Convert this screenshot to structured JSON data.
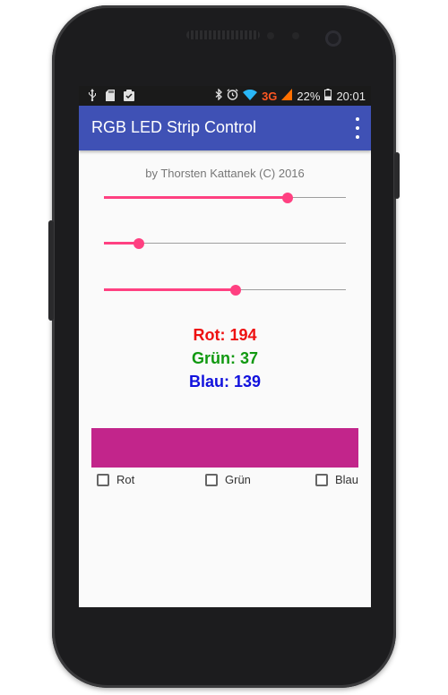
{
  "statusbar": {
    "left_icons": [
      "usb-icon",
      "sd-card-icon",
      "clipboard-icon"
    ],
    "network": "3G",
    "battery": "22%",
    "time": "20:01"
  },
  "appbar": {
    "title": "RGB LED Strip Control"
  },
  "byline": "by Thorsten Kattanek (C) 2016",
  "sliders": {
    "red": {
      "value": 194,
      "max": 255
    },
    "green": {
      "value": 37,
      "max": 255
    },
    "blue": {
      "value": 139,
      "max": 255
    }
  },
  "values": {
    "red_text": "Rot: 194",
    "green_text": "Grün: 37",
    "blue_text": "Blau: 139"
  },
  "colors": {
    "red": "#ee1111",
    "green": "#119911",
    "blue": "#1111dd",
    "accent": "#ff4081",
    "appbar": "#3f51b5",
    "swatch": "#c2258b"
  },
  "checkboxes": {
    "red_label": "Rot",
    "green_label": "Grün",
    "blue_label": "Blau"
  }
}
